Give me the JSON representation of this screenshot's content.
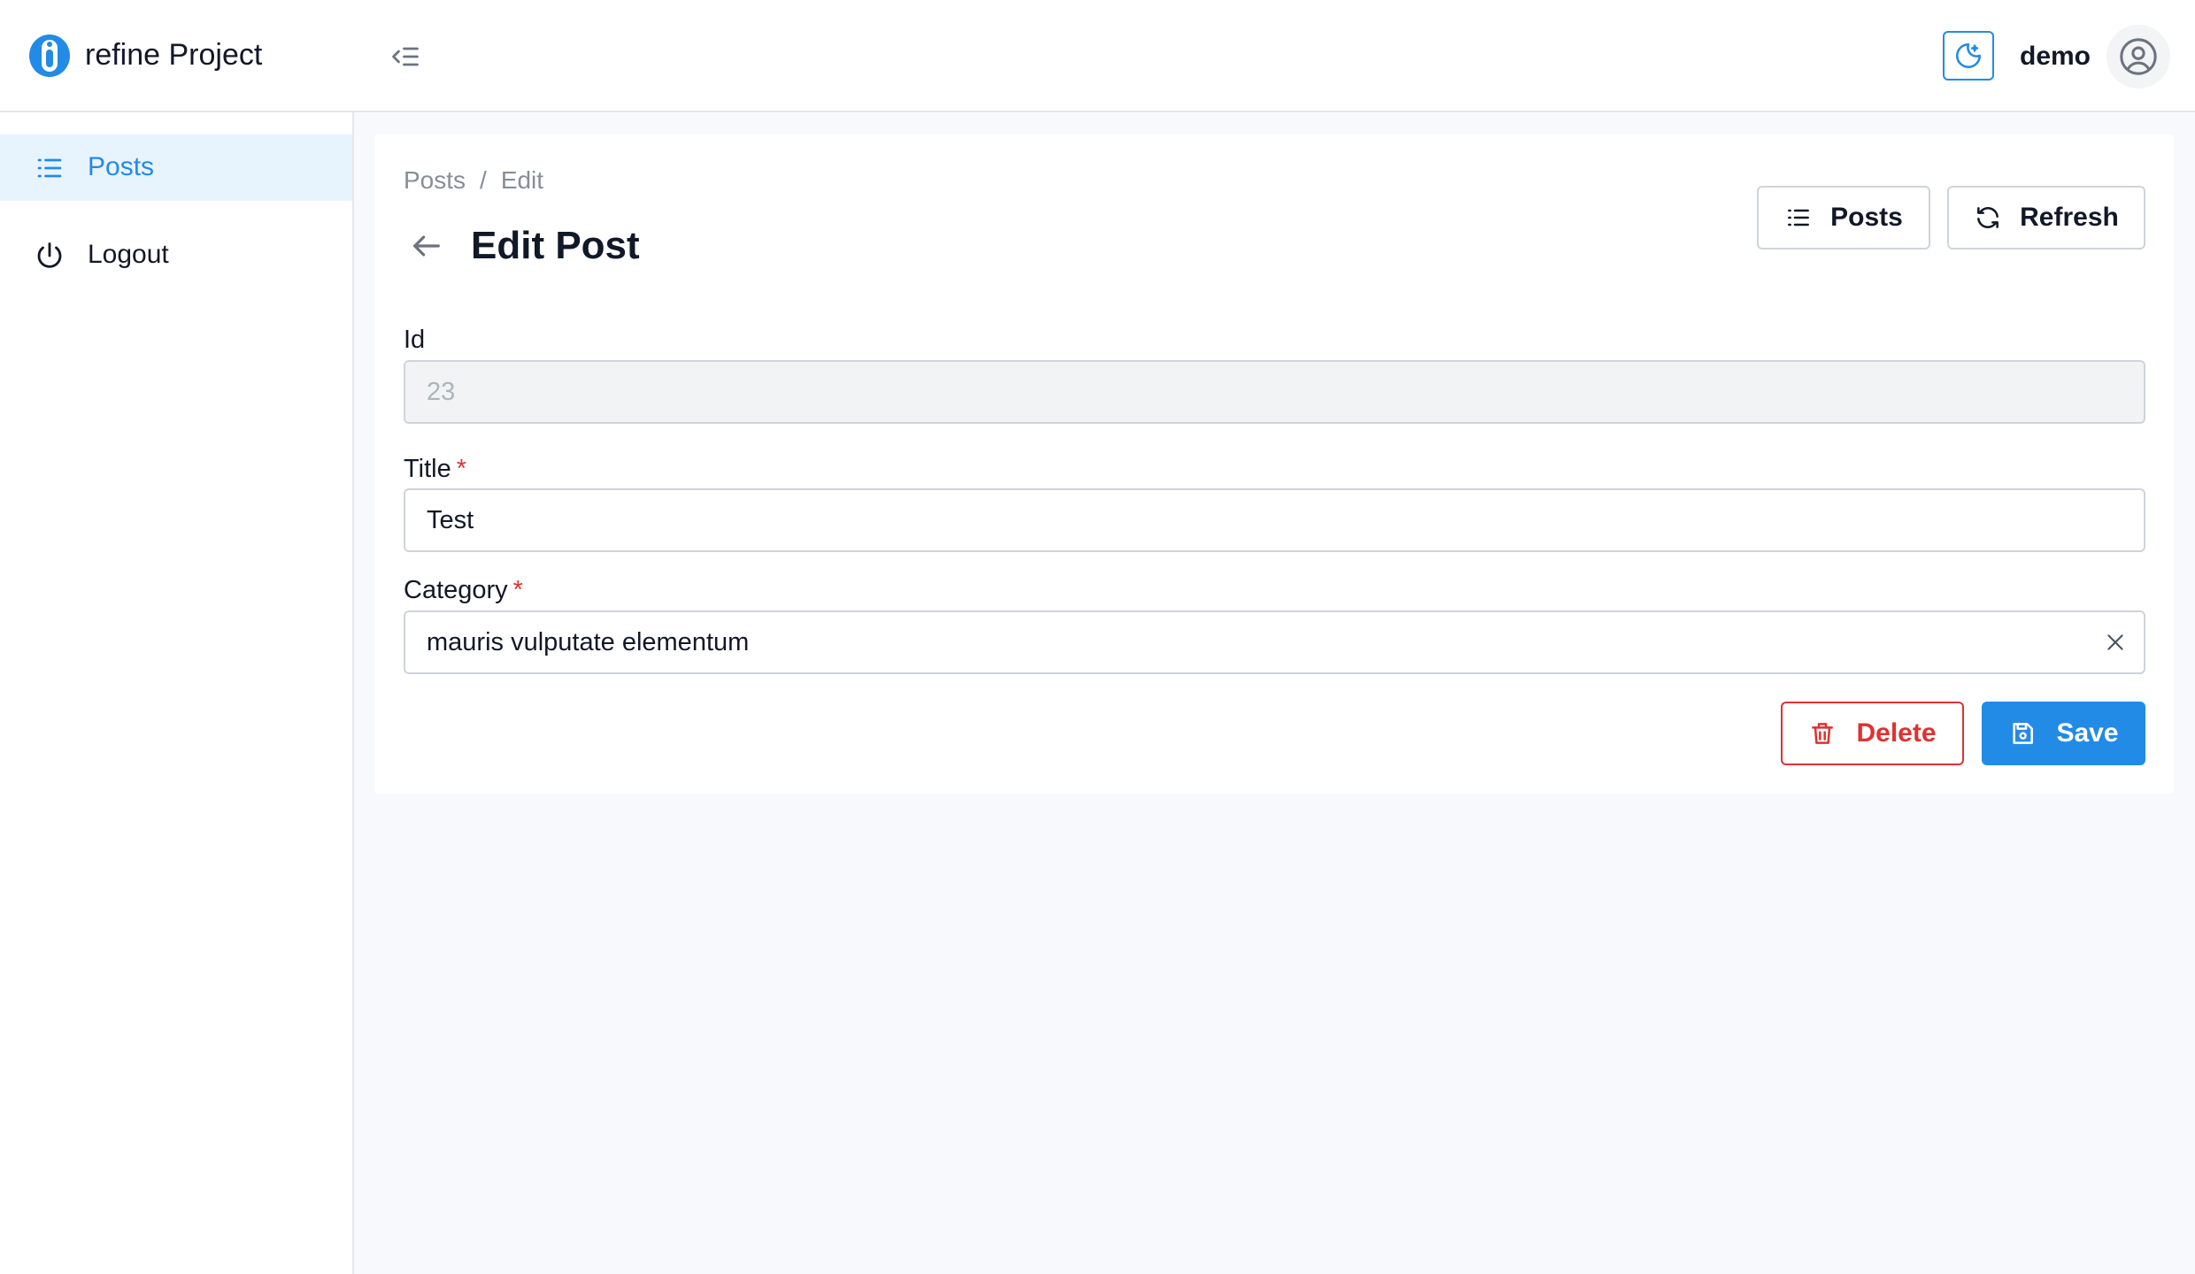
{
  "header": {
    "app_title": "refine Project",
    "username": "demo",
    "accent_color": "#228be6"
  },
  "sidebar": {
    "items": [
      {
        "label": "Posts",
        "icon": "list-icon",
        "active": true
      },
      {
        "label": "Logout",
        "icon": "power-icon",
        "active": false
      }
    ]
  },
  "page": {
    "breadcrumb": [
      "Posts",
      "Edit"
    ],
    "breadcrumb_separator": "/",
    "title": "Edit Post",
    "list_button_label": "Posts",
    "refresh_button_label": "Refresh"
  },
  "form": {
    "id": {
      "label": "Id",
      "value": "23"
    },
    "title": {
      "label": "Title",
      "value": "Test",
      "required_mark": "*"
    },
    "category": {
      "label": "Category",
      "value": "mauris vulputate elementum",
      "required_mark": "*"
    }
  },
  "actions": {
    "delete_label": "Delete",
    "save_label": "Save",
    "danger_color": "#e03131"
  }
}
